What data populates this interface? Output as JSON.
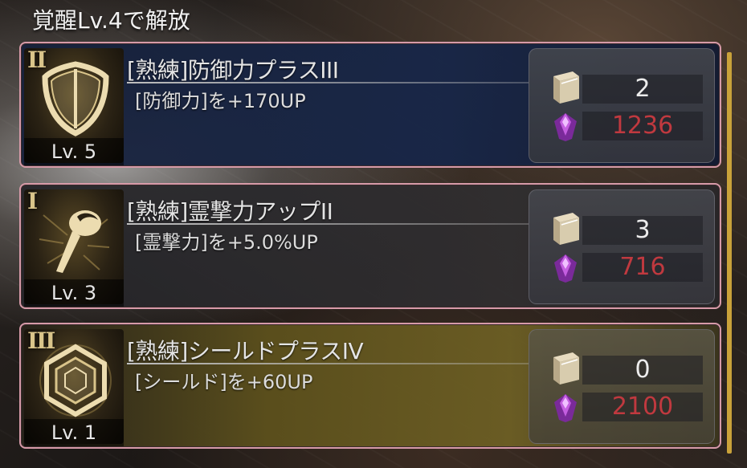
{
  "header": {
    "title": "覚醒Lv.4で解放"
  },
  "skills": [
    {
      "rank": "II",
      "icon": "shield-icon",
      "level_label": "Lv. 5",
      "title": "[熟練]防御力プラスIII",
      "description": "[防御力]を+170UP",
      "book_cost": "2",
      "gem_cost": "1236"
    },
    {
      "rank": "I",
      "icon": "power-orb-icon",
      "level_label": "Lv. 3",
      "title": "[熟練]霊撃力アップII",
      "description": "[霊撃力]を+5.0%UP",
      "book_cost": "3",
      "gem_cost": "716"
    },
    {
      "rank": "III",
      "icon": "hexagon-shield-icon",
      "level_label": "Lv. 1",
      "title": "[熟練]シールドプラスIV",
      "description": "[シールド]を+60UP",
      "book_cost": "0",
      "gem_cost": "2100"
    }
  ],
  "colors": {
    "card_border": "#d69aa8",
    "gem_cost_text": "#c0393f",
    "scrollbar": "#c9a23a"
  }
}
